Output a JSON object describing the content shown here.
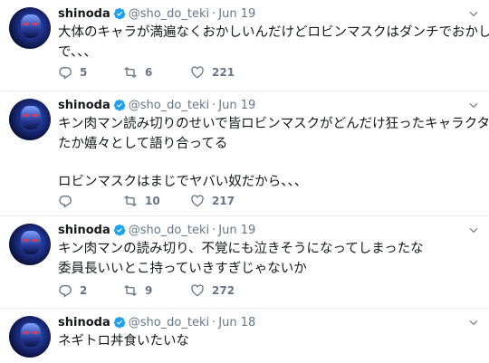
{
  "tweets": [
    {
      "name": "shinoda",
      "handle": "@sho_do_teki",
      "date": "Jun 19",
      "lines": [
        "大体のキャラが満遍なくおかしいんだけどロビンマスクはダンチでおかしいの",
        "で、、、"
      ],
      "replies": "5",
      "retweets": "6",
      "likes": "221"
    },
    {
      "name": "shinoda",
      "handle": "@sho_do_teki",
      "date": "Jun 19",
      "lines": [
        "キン肉マン読み切りのせいで皆ロビンマスクがどんだけ狂ったキャラクターだっ",
        "たか嬉々として語り合ってる",
        "",
        "ロビンマスクはまじでヤバい奴だから、、、"
      ],
      "replies": "",
      "retweets": "10",
      "likes": "217"
    },
    {
      "name": "shinoda",
      "handle": "@sho_do_teki",
      "date": "Jun 19",
      "lines": [
        "キン肉マンの読み切り、不覚にも泣きそうになってしまったな",
        "委員長いいとこ持っていきすぎじゃないか"
      ],
      "replies": "2",
      "retweets": "9",
      "likes": "272"
    },
    {
      "name": "shinoda",
      "handle": "@sho_do_teki",
      "date": "Jun 18",
      "lines": [
        "ネギトロ丼食いたいな"
      ]
    }
  ],
  "separator": "·",
  "icons": {
    "verified": "verified-badge-icon",
    "caret": "chevron-down-icon",
    "reply": "reply-icon",
    "retweet": "retweet-icon",
    "like": "heart-icon"
  },
  "colors": {
    "verified": "#1da1f2",
    "muted": "#657786",
    "divider": "#e6ecf0"
  }
}
